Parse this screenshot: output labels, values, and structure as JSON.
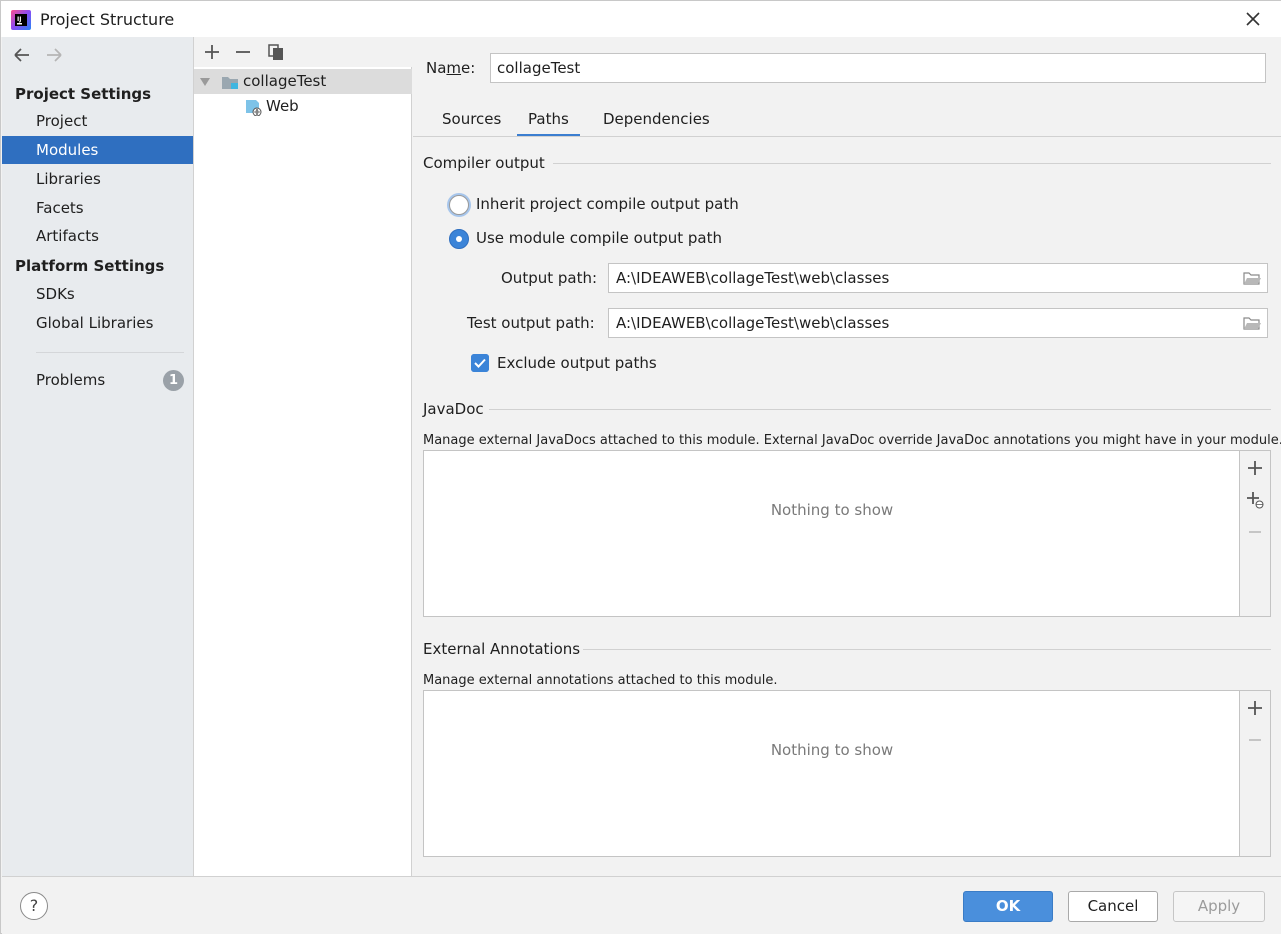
{
  "window": {
    "title": "Project Structure"
  },
  "sidebar": {
    "project_settings_title": "Project Settings",
    "project_items": [
      {
        "label": "Project"
      },
      {
        "label": "Modules"
      },
      {
        "label": "Libraries"
      },
      {
        "label": "Facets"
      },
      {
        "label": "Artifacts"
      }
    ],
    "selected_item": "Modules",
    "platform_settings_title": "Platform Settings",
    "platform_items": [
      {
        "label": "SDKs"
      },
      {
        "label": "Global Libraries"
      }
    ],
    "problems": {
      "label": "Problems",
      "count": "1"
    }
  },
  "tree": {
    "modules": [
      {
        "label": "collageTest",
        "expanded": true,
        "selected": true
      },
      {
        "label": "Web",
        "selected": false
      }
    ]
  },
  "module": {
    "name_label_pre": "Na",
    "name_label_mn": "m",
    "name_label_post": "e:",
    "name_value": "collageTest"
  },
  "tabs": [
    {
      "label": "Sources",
      "active": false
    },
    {
      "label": "Paths",
      "active": true
    },
    {
      "label": "Dependencies",
      "active": false
    }
  ],
  "compiler_output": {
    "title": "Compiler output",
    "inherit_label": "Inherit project compile output path",
    "inherit_selected": false,
    "use_module_label": "Use module compile output path",
    "use_module_selected": true,
    "output_path_label": "Output path:",
    "output_path_value": "A:\\IDEAWEB\\collageTest\\web\\classes",
    "test_output_path_label": "Test output path:",
    "test_output_path_value": "A:\\IDEAWEB\\collageTest\\web\\classes",
    "exclude_label": "Exclude output paths",
    "exclude_checked": true
  },
  "javadoc": {
    "title": "JavaDoc",
    "description": "Manage external JavaDocs attached to this module. External JavaDoc override JavaDoc annotations you might have in your module.",
    "empty_text": "Nothing to show"
  },
  "external_annotations": {
    "title": "External Annotations",
    "description": "Manage external annotations attached to this module.",
    "empty_text": "Nothing to show"
  },
  "footer": {
    "help_label": "?",
    "ok_label": "OK",
    "cancel_label": "Cancel",
    "apply_label": "Apply"
  },
  "colors": {
    "selection_blue": "#2f6fc0",
    "sidebar_bg": "#e8ebee",
    "ok_button": "#4a8fdc",
    "tab_underline": "#3b7ed0"
  }
}
